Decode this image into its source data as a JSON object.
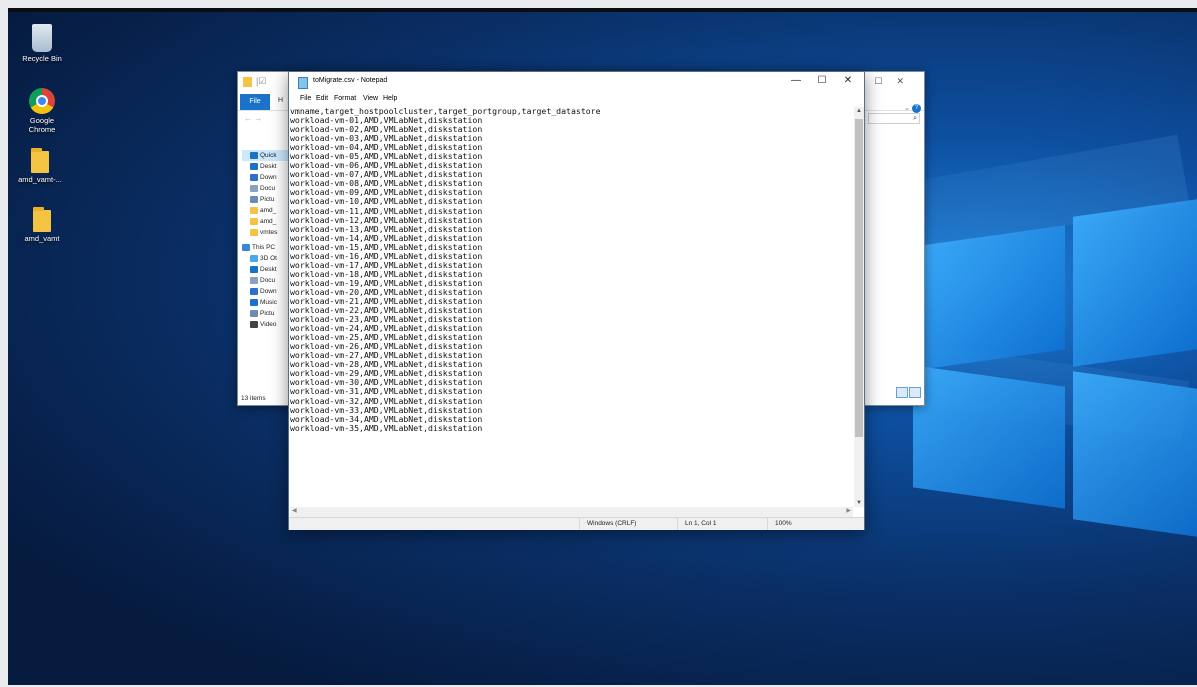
{
  "desktop": {
    "icons": [
      {
        "label": "Recycle Bin",
        "icon": "recycle-bin-icon"
      },
      {
        "label": "Google Chrome",
        "icon": "chrome-icon"
      },
      {
        "label": "amd_vamt-...",
        "icon": "folder-icon"
      },
      {
        "label": "amd_vamt",
        "icon": "folder-icon"
      }
    ]
  },
  "explorer": {
    "file_tab": "File",
    "home_tab": "H",
    "sidebar": [
      {
        "label": "Quick",
        "icon": "star-icon",
        "color": "#1a73c8"
      },
      {
        "label": "Deskt",
        "icon": "desktop-icon",
        "color": "#1a73c8"
      },
      {
        "label": "Down",
        "icon": "download-icon",
        "color": "#2f6fd1"
      },
      {
        "label": "Docu",
        "icon": "document-icon",
        "color": "#8aa2bd"
      },
      {
        "label": "Pictu",
        "icon": "pictures-icon",
        "color": "#6c8db0"
      },
      {
        "label": "amd_",
        "icon": "folder-icon",
        "color": "#f5c342"
      },
      {
        "label": "amd_",
        "icon": "folder-icon",
        "color": "#f5c342"
      },
      {
        "label": "vmtes",
        "icon": "folder-icon",
        "color": "#f5c342"
      },
      {
        "label": "This PC",
        "icon": "pc-icon",
        "color": "#3a86d8"
      },
      {
        "label": "3D Ot",
        "icon": "3d-objects-icon",
        "color": "#4aa7e8"
      },
      {
        "label": "Deskt",
        "icon": "desktop-icon",
        "color": "#1a73c8"
      },
      {
        "label": "Docu",
        "icon": "document-icon",
        "color": "#8aa2bd"
      },
      {
        "label": "Down",
        "icon": "download-icon",
        "color": "#2f6fd1"
      },
      {
        "label": "Music",
        "icon": "music-icon",
        "color": "#1a73c8"
      },
      {
        "label": "Pictu",
        "icon": "pictures-icon",
        "color": "#6c8db0"
      },
      {
        "label": "Video",
        "icon": "video-icon",
        "color": "#444444"
      }
    ],
    "items_count": "13 items"
  },
  "notepad": {
    "title": "toMigrate.csv - Notepad",
    "menu": [
      "File",
      "Edit",
      "Format",
      "View",
      "Help"
    ],
    "lines": [
      "vmname,target_hostpoolcluster,target_portgroup,target_datastore",
      "workload-vm-01,AMD,VMLabNet,diskstation",
      "workload-vm-02,AMD,VMLabNet,diskstation",
      "workload-vm-03,AMD,VMLabNet,diskstation",
      "workload-vm-04,AMD,VMLabNet,diskstation",
      "workload-vm-05,AMD,VMLabNet,diskstation",
      "workload-vm-06,AMD,VMLabNet,diskstation",
      "workload-vm-07,AMD,VMLabNet,diskstation",
      "workload-vm-08,AMD,VMLabNet,diskstation",
      "workload-vm-09,AMD,VMLabNet,diskstation",
      "workload-vm-10,AMD,VMLabNet,diskstation",
      "workload-vm-11,AMD,VMLabNet,diskstation",
      "workload-vm-12,AMD,VMLabNet,diskstation",
      "workload-vm-13,AMD,VMLabNet,diskstation",
      "workload-vm-14,AMD,VMLabNet,diskstation",
      "workload-vm-15,AMD,VMLabNet,diskstation",
      "workload-vm-16,AMD,VMLabNet,diskstation",
      "workload-vm-17,AMD,VMLabNet,diskstation",
      "workload-vm-18,AMD,VMLabNet,diskstation",
      "workload-vm-19,AMD,VMLabNet,diskstation",
      "workload-vm-20,AMD,VMLabNet,diskstation",
      "workload-vm-21,AMD,VMLabNet,diskstation",
      "workload-vm-22,AMD,VMLabNet,diskstation",
      "workload-vm-23,AMD,VMLabNet,diskstation",
      "workload-vm-24,AMD,VMLabNet,diskstation",
      "workload-vm-25,AMD,VMLabNet,diskstation",
      "workload-vm-26,AMD,VMLabNet,diskstation",
      "workload-vm-27,AMD,VMLabNet,diskstation",
      "workload-vm-28,AMD,VMLabNet,diskstation",
      "workload-vm-29,AMD,VMLabNet,diskstation",
      "workload-vm-30,AMD,VMLabNet,diskstation",
      "workload-vm-31,AMD,VMLabNet,diskstation",
      "workload-vm-32,AMD,VMLabNet,diskstation",
      "workload-vm-33,AMD,VMLabNet,diskstation",
      "workload-vm-34,AMD,VMLabNet,diskstation",
      "workload-vm-35,AMD,VMLabNet,diskstation"
    ],
    "status": {
      "line_ending": "Windows (CRLF)",
      "position": "Ln 1, Col 1",
      "zoom": "100%"
    }
  }
}
